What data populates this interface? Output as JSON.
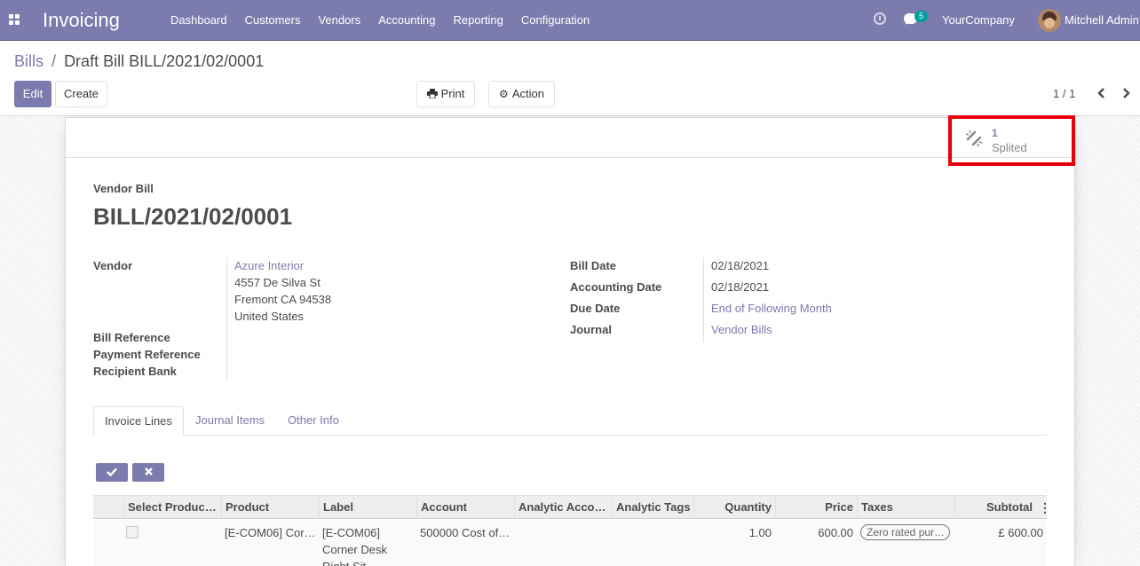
{
  "navbar": {
    "app_title": "Invoicing",
    "menu": [
      "Dashboard",
      "Customers",
      "Vendors",
      "Accounting",
      "Reporting",
      "Configuration"
    ],
    "messages_count": "5",
    "company": "YourCompany",
    "user": "Mitchell Admin"
  },
  "breadcrumb": {
    "parent": "Bills",
    "separator": "/",
    "current": "Draft Bill BILL/2021/02/0001"
  },
  "toolbar": {
    "edit": "Edit",
    "create": "Create",
    "print": "Print",
    "action": "Action"
  },
  "pager": "1 / 1",
  "smart_button": {
    "count": "1",
    "label": "Splited"
  },
  "form": {
    "type_label": "Vendor Bill",
    "name": "BILL/2021/02/0001",
    "vendor_label": "Vendor",
    "vendor_name": "Azure Interior",
    "vendor_address": [
      "4557 De Silva St",
      "Fremont CA 94538",
      "United States"
    ],
    "bill_reference_label": "Bill Reference",
    "payment_reference_label": "Payment Reference",
    "recipient_bank_label": "Recipient Bank",
    "bill_date_label": "Bill Date",
    "bill_date": "02/18/2021",
    "accounting_date_label": "Accounting Date",
    "accounting_date": "02/18/2021",
    "due_date_label": "Due Date",
    "due_date": "End of Following Month",
    "journal_label": "Journal",
    "journal": "Vendor Bills"
  },
  "tabs": [
    "Invoice Lines",
    "Journal Items",
    "Other Info"
  ],
  "table": {
    "columns": [
      "Select Produc…",
      "Product",
      "Label",
      "Account",
      "Analytic Acco…",
      "Analytic Tags",
      "Quantity",
      "Price",
      "Taxes",
      "Subtotal"
    ],
    "rows": [
      {
        "product": "[E-COM06] Cor…",
        "label_lines": [
          "[E-COM06]",
          "Corner Desk",
          "Right Sit"
        ],
        "account": "500000 Cost of…",
        "analytic_account": "",
        "analytic_tags": "",
        "quantity": "1.00",
        "price": "600.00",
        "taxes": "Zero rated pur…",
        "subtotal": "£ 600.00"
      }
    ]
  },
  "colors": {
    "primary": "#7c7bad",
    "highlight": "#e6000a",
    "badge": "#00a09d"
  }
}
